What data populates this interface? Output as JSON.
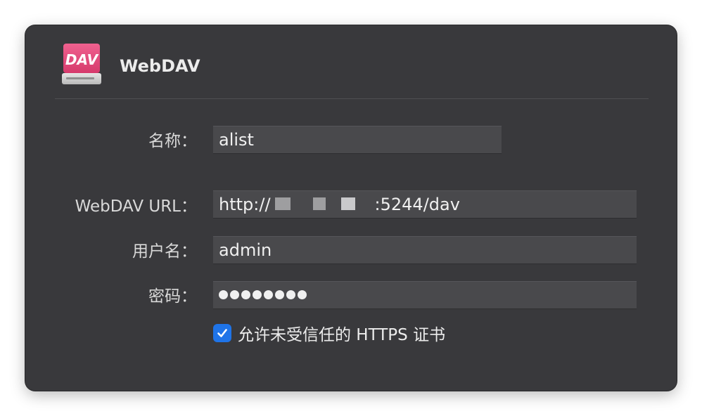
{
  "app": {
    "title": "WebDAV",
    "icon": "webdav-drive-icon",
    "icon_text": "DAV"
  },
  "form": {
    "name": {
      "label": "名称：",
      "value": "alist"
    },
    "url": {
      "label": "WebDAV URL：",
      "prefix": "http://",
      "suffix": ":5244/dav"
    },
    "username": {
      "label": "用户名：",
      "value": "admin"
    },
    "password": {
      "label": "密码：",
      "masked_length": 8
    },
    "trust_https": {
      "label": "允许未受信任的 HTTPS 证书",
      "checked": true
    }
  },
  "colors": {
    "panel_bg": "#39393c",
    "field_bg": "#49494c",
    "accent": "#1f74e8",
    "icon_pink": "#e84a7f"
  }
}
